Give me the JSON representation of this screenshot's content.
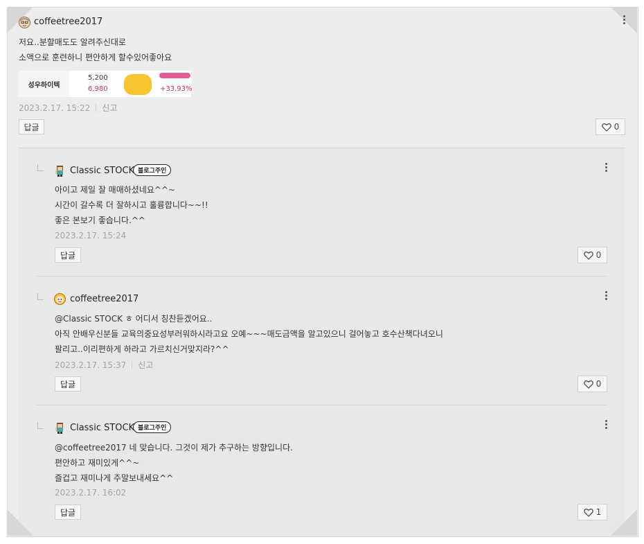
{
  "comment": {
    "author": "coffeetree2017",
    "lines": [
      "저요..분할매도도 알려주신대로",
      "소액으로 훈련하니 편안하게 할수있어좋아요"
    ],
    "stock": {
      "name": "성우하이텍",
      "price_top": "5,200",
      "price_bottom": "6,980",
      "change": "+33.93%"
    },
    "date": "2023.2.17. 15:22",
    "report": "신고",
    "reply_label": "답글",
    "likes": "0"
  },
  "replies": [
    {
      "author": "Classic STOCK",
      "badge": "블로그주인",
      "lines": [
        "아이고 제일 잘 매매하셨네요^^~",
        "시간이 갈수록 더 잘하시고 훌륭합니다~~!!",
        "좋은 본보기 좋습니다.^^"
      ],
      "date": "2023.2.17. 15:24",
      "reply_label": "답글",
      "likes": "0"
    },
    {
      "author": "coffeetree2017",
      "lines": [
        "@Classic STOCK ㅎ 어디서 칭찬듣겠어요..",
        "아직 안배우신분들 교육의중요성부러워하시라고요 오예~~~매도금액을 알고있으니 걸어놓고 호수산책다녀오니",
        "팔리고..이리편하게 하라고 가르치신거맞지라?^^"
      ],
      "date": "2023.2.17. 15:37",
      "report": "신고",
      "reply_label": "답글",
      "likes": "0"
    },
    {
      "author": "Classic STOCK",
      "badge": "블로그주인",
      "lines": [
        "@coffeetree2017 네 맞습니다. 그것이 제가 추구하는 방향입니다.",
        "편안하고 재미있게^^~",
        "즐겁고 재미나게 주말보내세요^^"
      ],
      "date": "2023.2.17. 16:02",
      "reply_label": "답글",
      "likes": "1"
    }
  ],
  "icons": {
    "more": "more-vertical-icon",
    "like": "heart-outline-icon",
    "reply_indent": "reply-elbow-icon"
  },
  "colors": {
    "panel": "#ededed",
    "reply_panel": "#e8e8e8",
    "price_up": "#c0335e",
    "scribble": "#f7c331"
  }
}
